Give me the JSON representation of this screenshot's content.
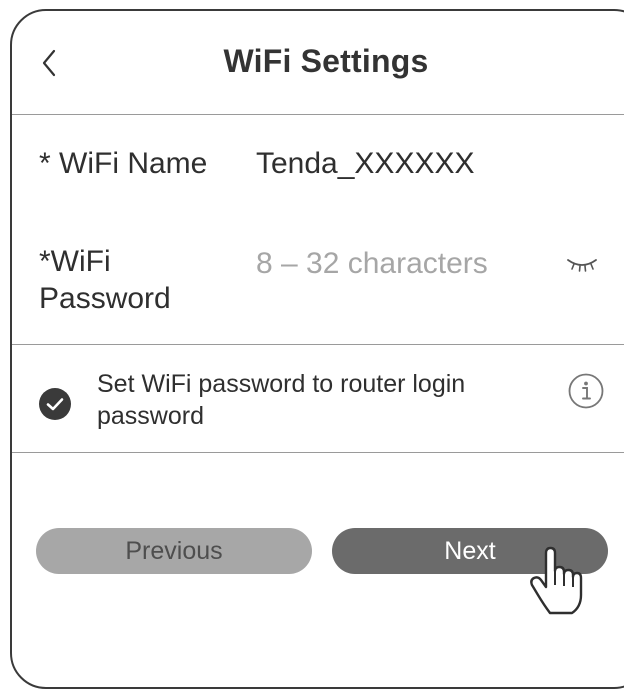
{
  "header": {
    "back_icon": "chevron-left-icon",
    "title": "WiFi Settings"
  },
  "form": {
    "wifi_name_label": "* WiFi Name",
    "wifi_name_value": "Tenda_XXXXXX",
    "wifi_password_label": "*WiFi Password",
    "wifi_password_value": "",
    "wifi_password_placeholder": "8 – 32 characters",
    "password_visibility_icon": "eye-closed-icon"
  },
  "option": {
    "checked": true,
    "label": "Set WiFi password to router login password",
    "info_icon": "info-icon"
  },
  "buttons": {
    "previous_label": "Previous",
    "next_label": "Next"
  },
  "cursor": "hand-pointer-icon",
  "colors": {
    "previous_bg": "#a7a7a7",
    "next_bg": "#6b6b6b",
    "checkbox": "#3a3a3a"
  }
}
